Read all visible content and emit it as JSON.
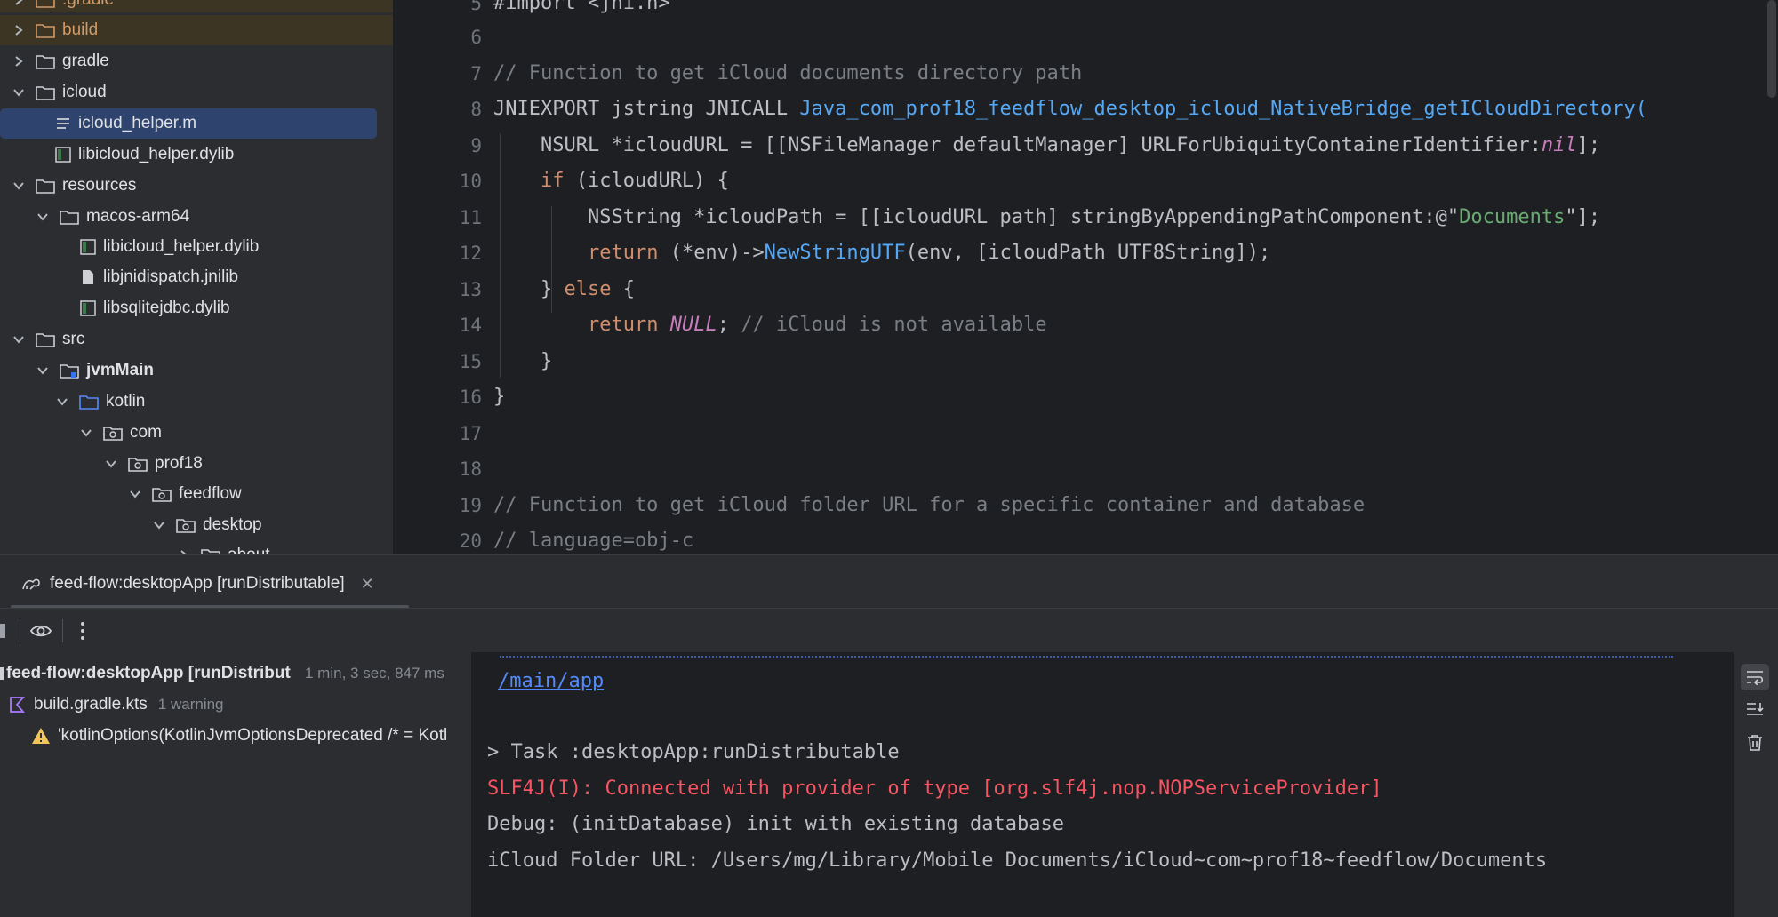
{
  "project_tree": {
    "items": [
      {
        "label": ".gradle",
        "depth": 0,
        "expanded": false,
        "type": "folder"
      },
      {
        "label": "build",
        "depth": 0,
        "expanded": false,
        "type": "folder"
      },
      {
        "label": "gradle",
        "depth": 0,
        "expanded": false,
        "type": "folder"
      },
      {
        "label": "icloud",
        "depth": 0,
        "expanded": true,
        "type": "folder"
      },
      {
        "label": "icloud_helper.m",
        "depth": 1,
        "type": "file",
        "selected": true
      },
      {
        "label": "libicloud_helper.dylib",
        "depth": 1,
        "type": "file"
      },
      {
        "label": "resources",
        "depth": 0,
        "expanded": true,
        "type": "folder"
      },
      {
        "label": "macos-arm64",
        "depth": 1,
        "expanded": true,
        "type": "folder"
      },
      {
        "label": "libicloud_helper.dylib",
        "depth": 2,
        "type": "file"
      },
      {
        "label": "libjnidispatch.jnilib",
        "depth": 2,
        "type": "file"
      },
      {
        "label": "libsqlitejdbc.dylib",
        "depth": 2,
        "type": "file"
      },
      {
        "label": "src",
        "depth": 0,
        "expanded": true,
        "type": "folder"
      },
      {
        "label": "jvmMain",
        "depth": 1,
        "expanded": true,
        "type": "module"
      },
      {
        "label": "kotlin",
        "depth": 2,
        "expanded": true,
        "type": "source-folder"
      },
      {
        "label": "com",
        "depth": 3,
        "expanded": true,
        "type": "package"
      },
      {
        "label": "prof18",
        "depth": 4,
        "expanded": true,
        "type": "package"
      },
      {
        "label": "feedflow",
        "depth": 5,
        "expanded": true,
        "type": "package"
      },
      {
        "label": "desktop",
        "depth": 6,
        "expanded": true,
        "type": "package"
      },
      {
        "label": "about",
        "depth": 7,
        "expanded": false,
        "type": "package"
      }
    ]
  },
  "editor": {
    "line_numbers": [
      "5",
      "6",
      "7",
      "8",
      "9",
      "10",
      "11",
      "12",
      "13",
      "14",
      "15",
      "16",
      "17",
      "18",
      "19",
      "20"
    ],
    "lines": {
      "l5": "#import <jni.h>",
      "l7": "// Function to get iCloud documents directory path",
      "l8a": "JNIEXPORT jstring JNICALL ",
      "l8b": "Java_com_prof18_feedflow_desktop_icloud_NativeBridge_getICloudDirectory(",
      "l9a": "    NSURL *icloudURL = [[NSFileManager defaultManager] URLForUbiquityContainerIdentifier:",
      "l9b": "nil",
      "l9c": "];",
      "l10a": "    ",
      "l10b": "if",
      "l10c": " (icloudURL) {",
      "l11a": "        NSString *icloudPath = [[icloudURL path] stringByAppendingPathComponent:@\"",
      "l11b": "Documents",
      "l11c": "\"];",
      "l12a": "        ",
      "l12b": "return",
      "l12c": " (*env)->",
      "l12d": "NewStringUTF",
      "l12e": "(env, [icloudPath UTF8String]);",
      "l13a": "    } ",
      "l13b": "else",
      "l13c": " {",
      "l14a": "        ",
      "l14b": "return",
      "l14c": " ",
      "l14d": "NULL",
      "l14e": "; ",
      "l14f": "// iCloud is not available",
      "l15": "    }",
      "l16": "}",
      "l19": "// Function to get iCloud folder URL for a specific container and database",
      "l20": "// language=obj-c"
    }
  },
  "run_panel": {
    "tab_label": "feed-flow:desktopApp [runDistributable]",
    "build_tree": {
      "root_label": "feed-flow:desktopApp [runDistribut",
      "root_time": "1 min, 3 sec, 847 ms",
      "file_label": "build.gradle.kts",
      "file_badge": "1 warning",
      "warning_label": "'kotlinOptions(KotlinJvmOptionsDeprecated /* = Kotl"
    },
    "console": {
      "link_path": "/main/app",
      "task_line": "> Task :desktopApp:runDistributable",
      "slf4j_line": "SLF4J(I): Connected with provider of type [org.slf4j.nop.NOPServiceProvider]",
      "debug_line": "Debug: (initDatabase) init with existing database",
      "icloud_line": "iCloud Folder URL: /Users/mg/Library/Mobile Documents/iCloud~com~prof18~feedflow/Documents"
    }
  },
  "colors": {
    "accent": "#2e436e",
    "error": "#f75464",
    "link": "#548af7",
    "keyword": "#cf8e6d",
    "function": "#56a8f5",
    "string": "#6aab73",
    "comment": "#7a7e85"
  }
}
